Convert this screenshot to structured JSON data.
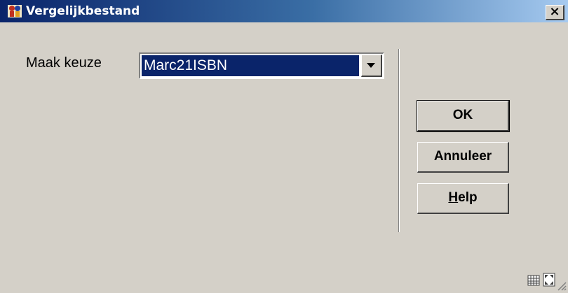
{
  "window": {
    "title": "Vergelijkbestand",
    "close_label": "×"
  },
  "form": {
    "choice_label": "Maak keuze",
    "choice_value": "Marc21ISBN"
  },
  "buttons": {
    "ok": "OK",
    "cancel": "Annuleer",
    "help_prefix": "H",
    "help_rest": "elp"
  },
  "icons": {
    "app": "app-logo-icon",
    "dropdown": "dropdown-arrow-icon",
    "grid": "grid-icon",
    "expand": "expand-icon",
    "resize": "resize-grip-icon"
  },
  "colors": {
    "title_bar_start": "#0a246a",
    "title_bar_end": "#a6caf0",
    "selection": "#0a246a",
    "face": "#d4d0c8"
  }
}
